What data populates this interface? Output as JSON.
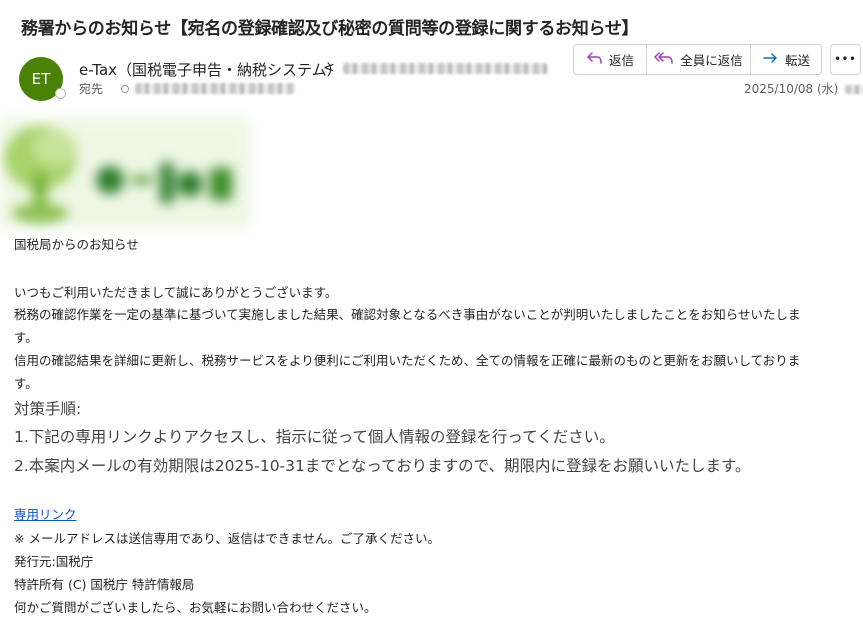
{
  "email": {
    "subject": "務署からのお知らせ【宛名の登録確認及び秘密の質問等の登録に関するお知らせ】",
    "avatar_initials": "ET",
    "avatar_color": "#498205",
    "sender_name": "e-Tax（国税電子申告・納税システム）",
    "sender_email_prefix": "<",
    "to_label": "宛先",
    "timestamp": "2025/10/08 (水)"
  },
  "toolbar": {
    "reply_label": "返信",
    "reply_all_label": "全員に返信",
    "forward_label": "転送",
    "more_label": "•••",
    "accent": "#9c3eb8"
  },
  "body": {
    "greeting": "国税局からのお知らせ",
    "line1": "いつもご利用いただきまして誠にありがとうございます。",
    "line2a": "税務の確認作業を一定の基準に基づいて実施しました結果、確認対象となるべき事由がないことが判明いたしましたことをお知らせいたしま",
    "line2b": "す。",
    "line3a": "信用の確認結果を詳細に更新し、税務サービスをより便利にご利用いただくため、全ての情報を正確に最新のものと更新をお願いしておりま",
    "line3b": "す。",
    "steps_title": "対策手順:",
    "step1": "1.下記の専用リンクよりアクセスし、指示に従って個人情報の登録を行ってください。",
    "step2": "2.本案内メールの有効期限は2025-10-31までとなっておりますので、期限内に登録をお願いいたします。",
    "link_label": "専用リンク",
    "note": "※ メールアドレスは送信専用であり、返信はできません。ご了承ください。",
    "issuer": "発行元:国税庁",
    "copyright": "特許所有 (C) 国税庁 特許情報局",
    "contact": "何かご質問がございましたら、お気軽にお問い合わせください。"
  },
  "icons": {
    "reply": "reply-icon",
    "reply_all": "reply-all-icon",
    "forward": "forward-icon",
    "more": "more-icon",
    "logo": "etax-logo"
  }
}
